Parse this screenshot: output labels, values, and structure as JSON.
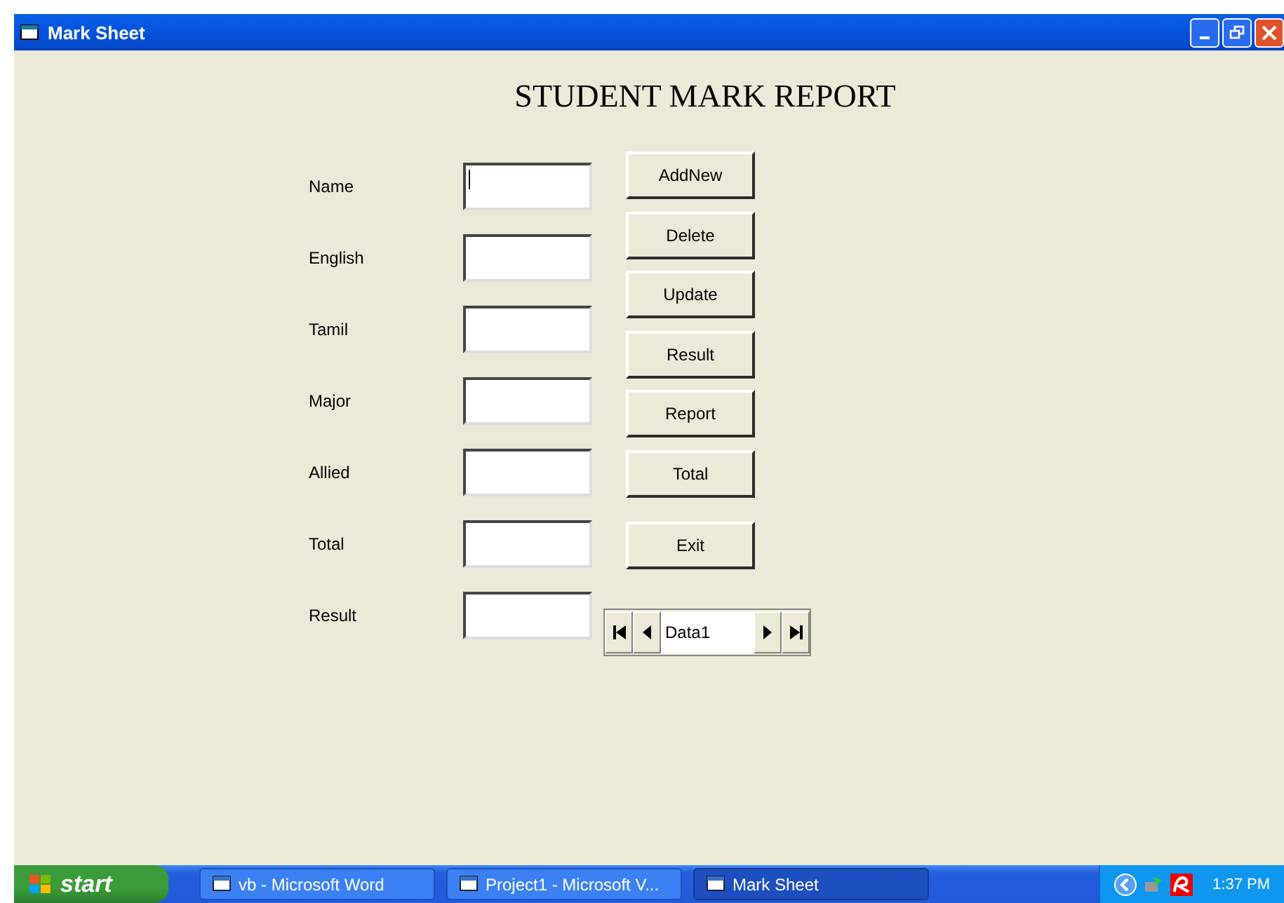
{
  "window": {
    "title": "Mark Sheet"
  },
  "heading": "STUDENT MARK REPORT",
  "fields": [
    {
      "label": "Name",
      "focused": true
    },
    {
      "label": "English",
      "focused": false
    },
    {
      "label": "Tamil",
      "focused": false
    },
    {
      "label": "Major",
      "focused": false
    },
    {
      "label": "Allied",
      "focused": false
    },
    {
      "label": "Total",
      "focused": false
    },
    {
      "label": "Result",
      "focused": false
    }
  ],
  "buttons": [
    "AddNew",
    "Delete",
    "Update",
    "Result",
    "Report",
    "Total",
    "Exit"
  ],
  "data_control": {
    "caption": "Data1"
  },
  "taskbar": {
    "start": "start",
    "tasks": [
      {
        "label": "vb - Microsoft Word",
        "selected": false
      },
      {
        "label": "Project1 - Microsoft V...",
        "selected": false
      },
      {
        "label": "Mark Sheet",
        "selected": true
      }
    ],
    "clock": "1:37 PM"
  }
}
